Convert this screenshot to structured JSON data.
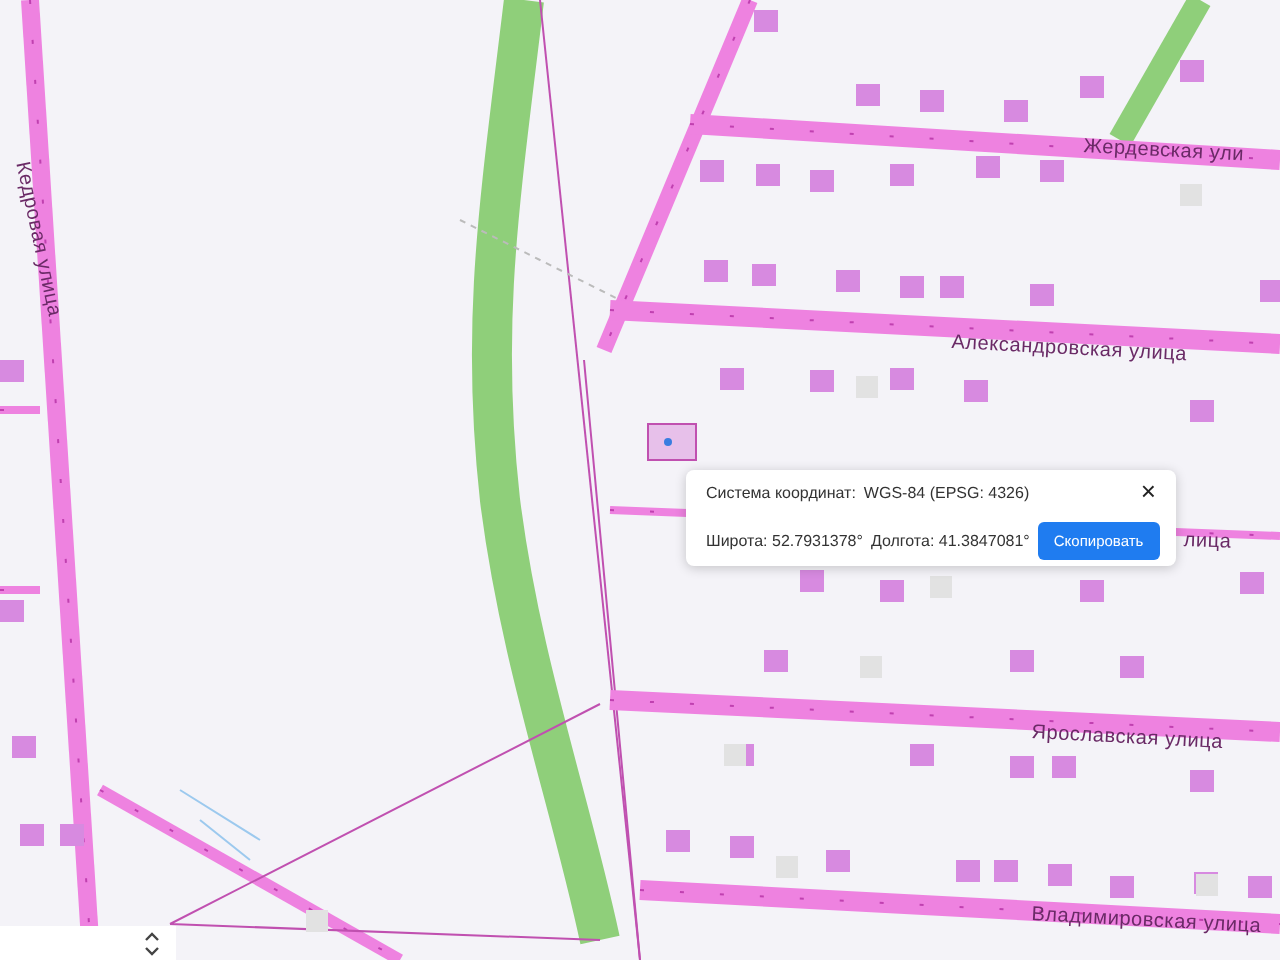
{
  "map": {
    "street_labels": [
      {
        "text": "Кедровая улица"
      },
      {
        "text": "Жердевская ули"
      },
      {
        "text": "Александровская улица"
      },
      {
        "text": "лица"
      },
      {
        "text": "Ярославская улица"
      },
      {
        "text": "Владимировская улица"
      }
    ]
  },
  "coordinate_popup": {
    "system_label": "Система координат:",
    "system_value": "WGS-84 (EPSG: 4326)",
    "latitude": "Широта: 52.7931378°",
    "longitude": "Долгота: 41.3847081°",
    "close": "×",
    "copy_button": "Скопировать"
  }
}
